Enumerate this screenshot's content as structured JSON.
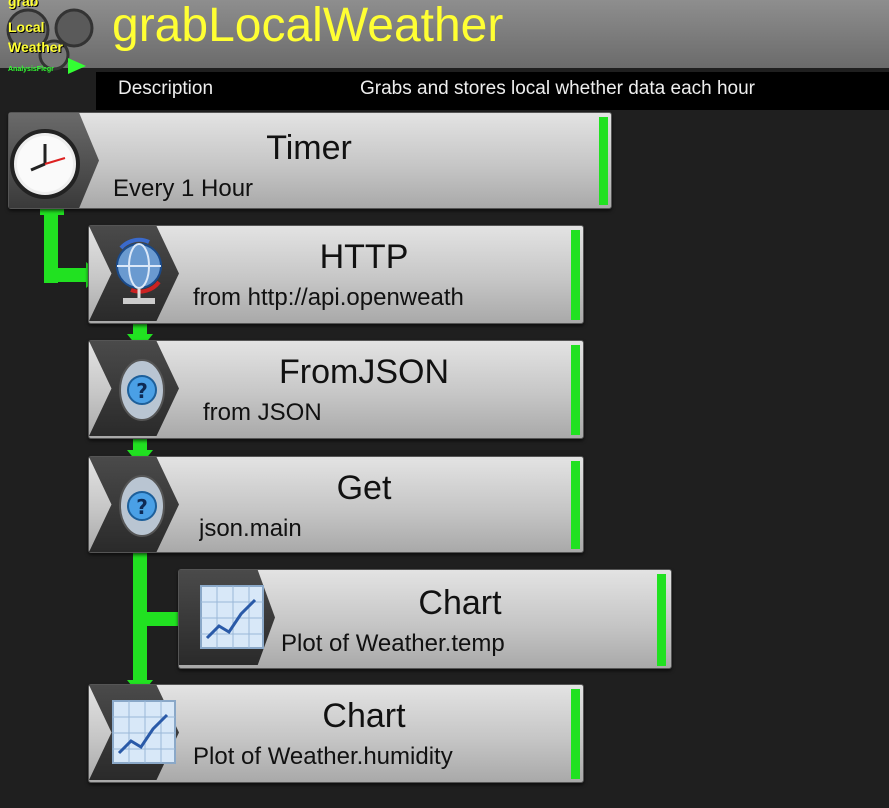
{
  "header": {
    "app_icon_lines": [
      "grab",
      "Local",
      "Weather"
    ],
    "app_icon_tiny": "AnalysisFlegr",
    "title": "grabLocalWeather"
  },
  "description": {
    "label": "Description",
    "value": "Grabs and stores local whether data each hour"
  },
  "nodes": [
    {
      "title": "Timer",
      "subtitle": "Every 1 Hour",
      "icon": "clock-icon",
      "status": "active"
    },
    {
      "title": "HTTP",
      "subtitle": "from http://api.openweath",
      "icon": "globe-network-icon",
      "status": "active"
    },
    {
      "title": "FromJSON",
      "subtitle": "from JSON",
      "icon": "question-icon",
      "status": "active"
    },
    {
      "title": "Get",
      "subtitle": "json.main",
      "icon": "question-icon",
      "status": "active"
    },
    {
      "title": "Chart",
      "subtitle": "Plot of Weather.temp",
      "icon": "line-chart-icon",
      "status": "active"
    },
    {
      "title": "Chart",
      "subtitle": "Plot of Weather.humidity",
      "icon": "line-chart-icon",
      "status": "active"
    }
  ],
  "colors": {
    "title": "#ffff33",
    "connector": "#21e121",
    "status": "#21e121",
    "background": "#1f1f1f"
  }
}
